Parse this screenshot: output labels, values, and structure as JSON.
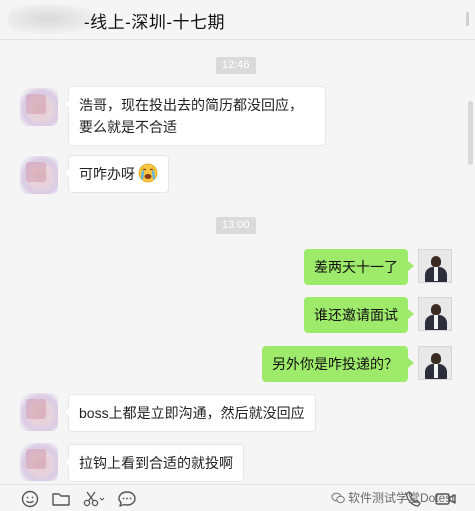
{
  "header": {
    "title": "-线上-深圳-十七期"
  },
  "chat": {
    "timestamps": [
      "12:46",
      "13:00"
    ],
    "messages": [
      {
        "side": "left",
        "text": "浩哥，现在投出去的简历都没回应，要么就是不合适"
      },
      {
        "side": "left",
        "text": "可咋办呀",
        "emoji": "crying-face"
      },
      {
        "side": "right",
        "text": "差两天十一了"
      },
      {
        "side": "right",
        "text": "谁还邀请面试"
      },
      {
        "side": "right",
        "text": "另外你是咋投递的？"
      },
      {
        "side": "left",
        "text": "boss上都是立即沟通，然后就没回应"
      },
      {
        "side": "left",
        "text": "拉钩上看到合适的就投啊"
      }
    ]
  },
  "toolbar": {
    "icons": [
      "emoji-icon",
      "folder-icon",
      "scissors-icon",
      "chat-bubble-icon",
      "phone-icon",
      "video-icon"
    ],
    "watermark": "软件测试学堂Dotest"
  },
  "colors": {
    "outgoing_bubble": "#9eea6a",
    "incoming_bubble": "#ffffff",
    "background": "#f5f5f5",
    "timestamp_bg": "#dadada"
  }
}
